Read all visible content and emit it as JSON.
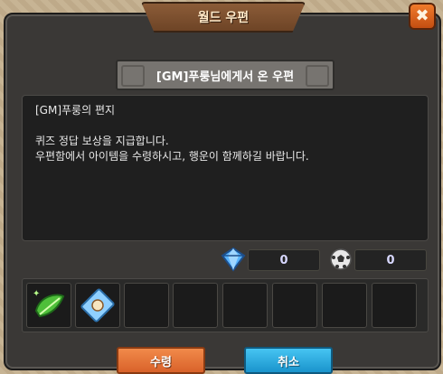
{
  "window": {
    "title": "월드 우편",
    "close_label": "✖"
  },
  "mail": {
    "subtitle": "[GM]푸룽님에게서 온 우편",
    "lines": [
      "[GM]푸룽의 편지",
      "",
      "퀴즈 정답 보상을 지급합니다.",
      "우편함에서 아이템을 수령하시고, 행운이 함께하길 바랍니다."
    ]
  },
  "currency": {
    "gem_icon": "diamond-gem-icon",
    "gem_value": "0",
    "ball_icon": "soccer-ball-icon",
    "ball_value": "0"
  },
  "attachments": {
    "items": [
      {
        "icon": "green-leaf-item-icon"
      },
      {
        "icon": "blue-card-item-icon"
      }
    ],
    "slot_count": 8
  },
  "buttons": {
    "confirm_label": "수령",
    "cancel_label": "취소"
  },
  "colors": {
    "confirm": "#e0703a",
    "cancel": "#2aa6dc",
    "title_tab": "#7a4e2e"
  }
}
